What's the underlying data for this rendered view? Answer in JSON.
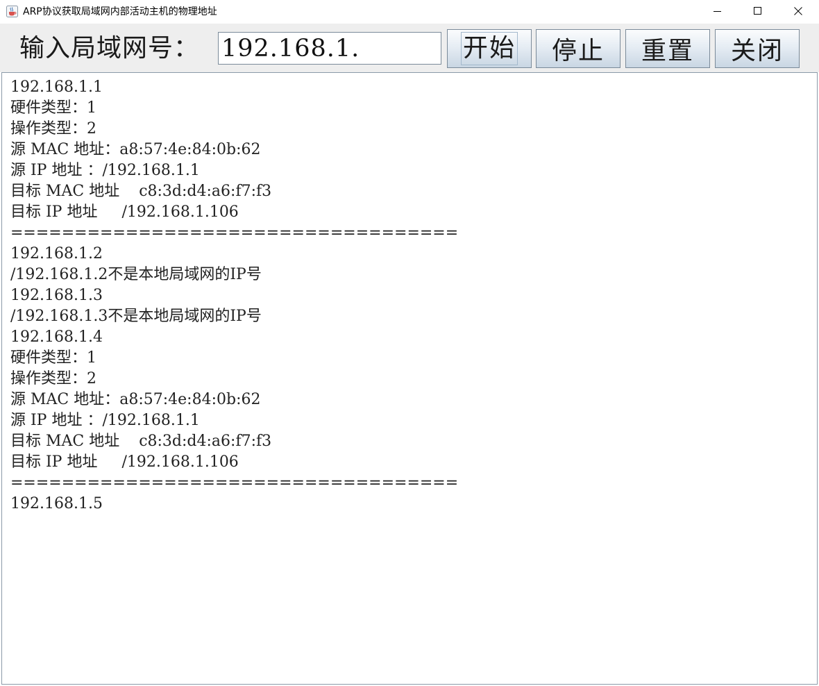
{
  "window": {
    "title": "ARP协议获取局域网内部活动主机的物理地址",
    "app_icon": "java-cup-icon",
    "controls": [
      "minimize-icon",
      "maximize-icon",
      "close-icon"
    ]
  },
  "toolbar": {
    "label": "输入局域网号：",
    "input_value": "192.168.1.",
    "start_label": "开始",
    "stop_label": "停止",
    "reset_label": "重置",
    "close_label": "关闭"
  },
  "output": {
    "lines": [
      "192.168.1.1",
      "硬件类型：1",
      "操作类型：2",
      "源 MAC 地址：a8:57:4e:84:0b:62",
      "源 IP 地址 ：/192.168.1.1",
      "目标 MAC 地址    c8:3d:d4:a6:f7:f3",
      "目标 IP 地址     /192.168.1.106",
      "===================================",
      "192.168.1.2",
      "/192.168.1.2不是本地局域网的IP号",
      "192.168.1.3",
      "/192.168.1.3不是本地局域网的IP号",
      "192.168.1.4",
      "硬件类型：1",
      "操作类型：2",
      "源 MAC 地址：a8:57:4e:84:0b:62",
      "源 IP 地址 ：/192.168.1.1",
      "目标 MAC 地址    c8:3d:d4:a6:f7:f3",
      "目标 IP 地址     /192.168.1.106",
      "===================================",
      "192.168.1.5"
    ]
  }
}
